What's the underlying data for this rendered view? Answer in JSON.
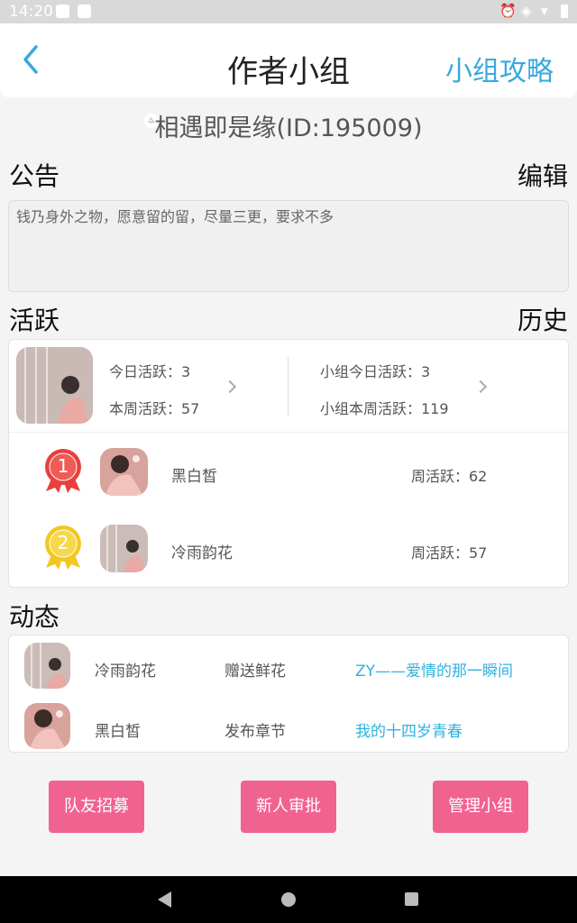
{
  "status_bar": {
    "time": "14:20"
  },
  "header": {
    "title": "作者小组",
    "right_link": "小组攻略"
  },
  "group": {
    "name": "相遇即是缘(ID:195009)"
  },
  "notice": {
    "title": "公告",
    "edit_label": "编辑",
    "content": "钱乃身外之物，愿意留的留，尽量三更，要求不多"
  },
  "activity": {
    "title": "活跃",
    "history_label": "历史",
    "today_label": "今日活跃：3",
    "week_label": "本周活跃：57",
    "group_today_label": "小组今日活跃：3",
    "group_week_label": "小组本周活跃：119",
    "ranking": [
      {
        "rank": "1",
        "name": "黑白皙",
        "weekly": "周活跃：62"
      },
      {
        "rank": "2",
        "name": "冷雨韵花",
        "weekly": "周活跃：57"
      }
    ]
  },
  "feed": {
    "title": "动态",
    "items": [
      {
        "name": "冷雨韵花",
        "action": "赠送鲜花",
        "target": "ZY——爱情的那一瞬间"
      },
      {
        "name": "黑白皙",
        "action": "发布章节",
        "target": "我的十四岁青春"
      }
    ]
  },
  "buttons": {
    "recruit": "队友招募",
    "review": "新人审批",
    "manage": "管理小组"
  },
  "colors": {
    "accent_blue": "#38a9de",
    "link_blue": "#2fb2e0",
    "button_pink": "#f06390",
    "medal_red": "#e8403c",
    "medal_gold": "#f2c81f"
  }
}
